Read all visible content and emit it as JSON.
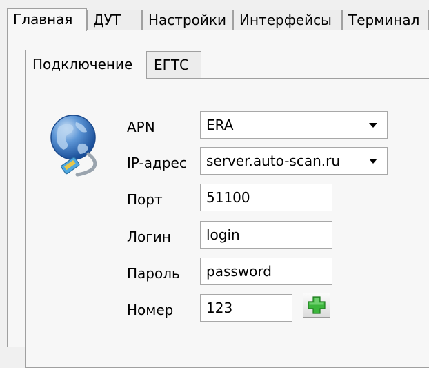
{
  "top_tabs": {
    "items": [
      {
        "label": "Главная"
      },
      {
        "label": "ДУТ"
      },
      {
        "label": "Настройки"
      },
      {
        "label": "Интерфейсы"
      },
      {
        "label": "Терминал"
      }
    ]
  },
  "inner_tabs": {
    "items": [
      {
        "label": "Подключение"
      },
      {
        "label": "ЕГТС"
      }
    ]
  },
  "form": {
    "apn": {
      "label": "APN",
      "value": "ERA"
    },
    "ip": {
      "label": "IP-адрес",
      "value": "server.auto-scan.ru"
    },
    "port": {
      "label": "Порт",
      "value": "51100"
    },
    "login": {
      "label": "Логин",
      "value": "login"
    },
    "password": {
      "label": "Пароль",
      "value": "password"
    },
    "number": {
      "label": "Номер",
      "value": "123"
    }
  },
  "icons": {
    "connection": "globe-network-icon",
    "add": "plus-icon"
  },
  "colors": {
    "plus_green": "#3cb63c",
    "globe_blue": "#2f6fbf"
  }
}
